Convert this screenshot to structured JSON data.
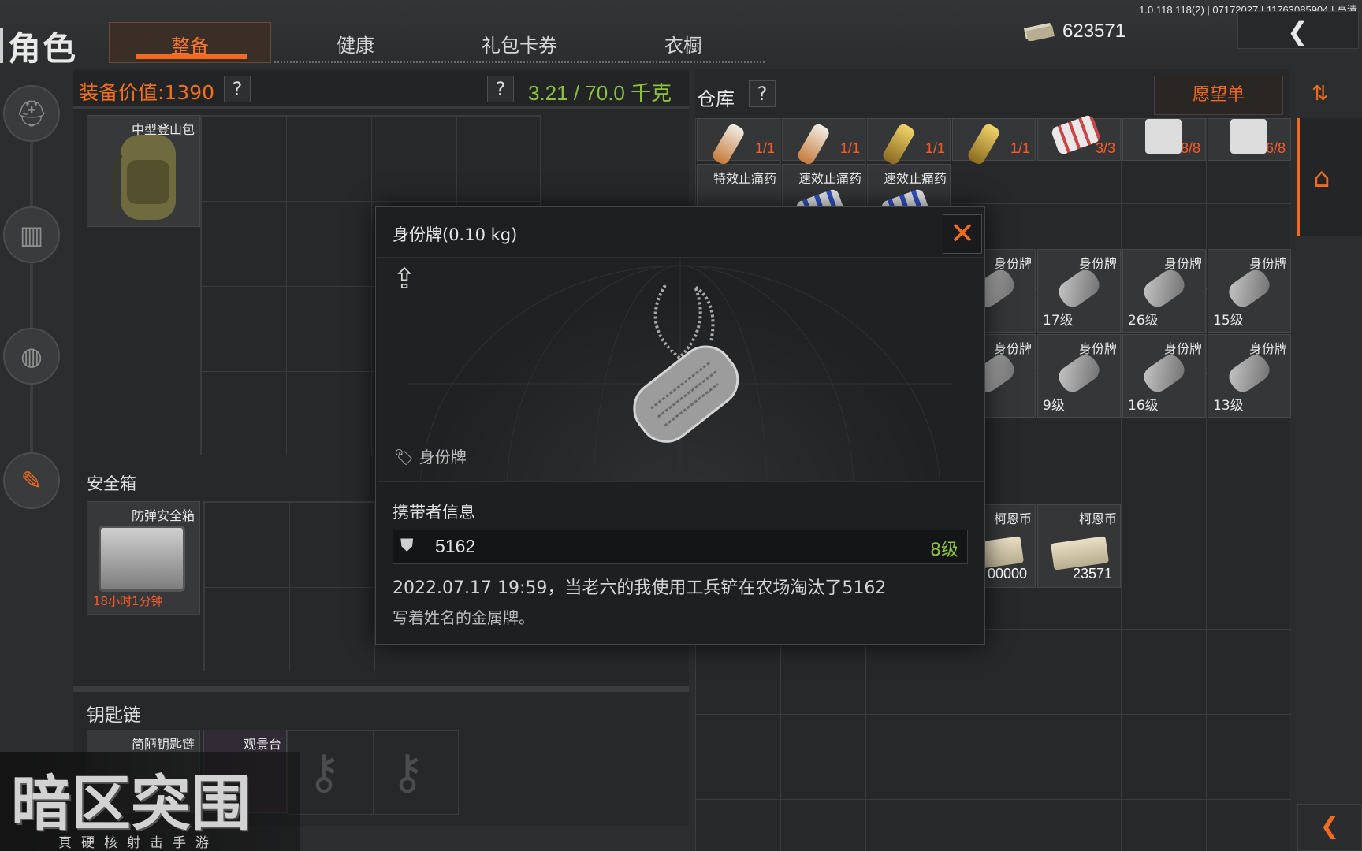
{
  "version_info": "1.0.118.118(2) | 07172027 | 11763085904 | 高清",
  "header": {
    "title": "角色",
    "tabs": [
      {
        "label": "整备",
        "active": true
      },
      {
        "label": "健康",
        "active": false
      },
      {
        "label": "礼包卡券",
        "active": false
      },
      {
        "label": "衣橱",
        "active": false
      }
    ],
    "currency_value": "623571"
  },
  "equipment": {
    "value_label": "装备价值:1390",
    "help": "?",
    "weight": "3.21 / 70.0 千克",
    "backpack_label": "中型登山包",
    "safe_box_section": "安全箱",
    "safe_box_label": "防弹安全箱",
    "safe_box_timer": "18小时1分钟",
    "keychain_section": "钥匙链",
    "keychain_items": [
      "简陋钥匙链",
      "观景台"
    ]
  },
  "warehouse": {
    "title": "仓库",
    "help": "?",
    "wishlist_label": "愿望单",
    "top_row_counts": [
      "1/1",
      "1/1",
      "1/1",
      "1/1",
      "3/3",
      "8/8",
      "6/8"
    ],
    "medicine_labels": [
      "特效止痛药",
      "速效止痛药",
      "速效止痛药"
    ],
    "dogtag_label": "身份牌",
    "dogtag_row1_levels": [
      "17级",
      "26级",
      "15级"
    ],
    "dogtag_row2_levels": [
      "9级",
      "16级",
      "13级"
    ],
    "cash_label": "柯恩币",
    "cash_values": [
      "00000",
      "23571"
    ]
  },
  "modal": {
    "title": "身份牌(0.10 kg)",
    "item_type": "身份牌",
    "carrier_heading": "携带者信息",
    "carrier_name": "5162",
    "carrier_level": "8级",
    "kill_log": "2022.07.17 19:59，当老六的我使用工兵铲在农场淘汰了5162",
    "description": "写着姓名的金属牌。"
  },
  "logo": {
    "title": "暗区突围",
    "subtitle": "真硬核射击手游"
  },
  "colors": {
    "accent": "#f26b21",
    "weight_green": "#8dc23d",
    "count_red": "#ff5b2a"
  }
}
